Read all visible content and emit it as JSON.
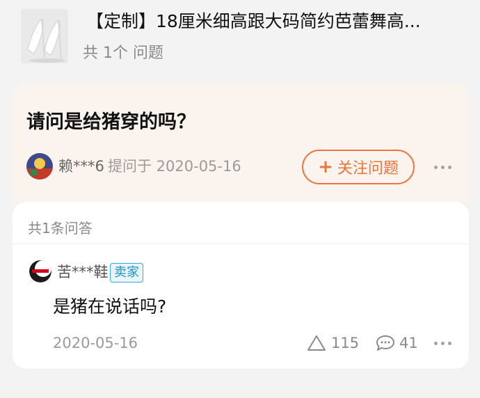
{
  "product": {
    "title": "【定制】18厘米细高跟大码简约芭蕾舞高...",
    "question_count": "共 1个 问题",
    "thumbnail_icon": "white-high-heel-shoes-image"
  },
  "question": {
    "text": "请问是给猪穿的吗？",
    "asker_name": "赖***6",
    "asked_meta": "提问于 2020-05-16",
    "follow_label": "关注问题",
    "follow_icon": "plus-icon",
    "accent_color": "#f0733a"
  },
  "answers": {
    "count_label": "共1条问答",
    "items": [
      {
        "seller_name": "苦***鞋",
        "badge": "卖家",
        "text": "是猪在说话吗?",
        "date": "2020-05-16",
        "likes": "115",
        "comments": "41"
      }
    ]
  }
}
